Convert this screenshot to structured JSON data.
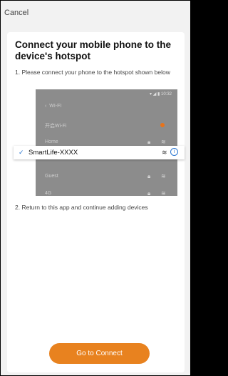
{
  "topbar": {
    "cancel_label": "Cancel"
  },
  "card": {
    "title": "Connect your mobile phone to the device's hotspot",
    "step1": "1. Please connect your phone to the hotspot shown below",
    "step2": "2. Return to this app and continue adding devices",
    "connect_button": "Go to Connect"
  },
  "wifi_list": {
    "status_time": "10:32",
    "header_label": "WI-FI",
    "rows": [
      {
        "label": "开启Wi-Fi"
      },
      {
        "label": "Home"
      },
      {
        "label": "Guest"
      },
      {
        "label": "4G"
      }
    ],
    "highlight": {
      "ssid": "SmartLife-XXXX"
    }
  },
  "colors": {
    "accent": "#e8821f",
    "link_blue": "#2a76d2",
    "toggle_orange": "#e8731a"
  },
  "icons": {
    "check": "check-icon",
    "wifi": "wifi-icon",
    "lock": "lock-icon",
    "info": "info-icon"
  }
}
